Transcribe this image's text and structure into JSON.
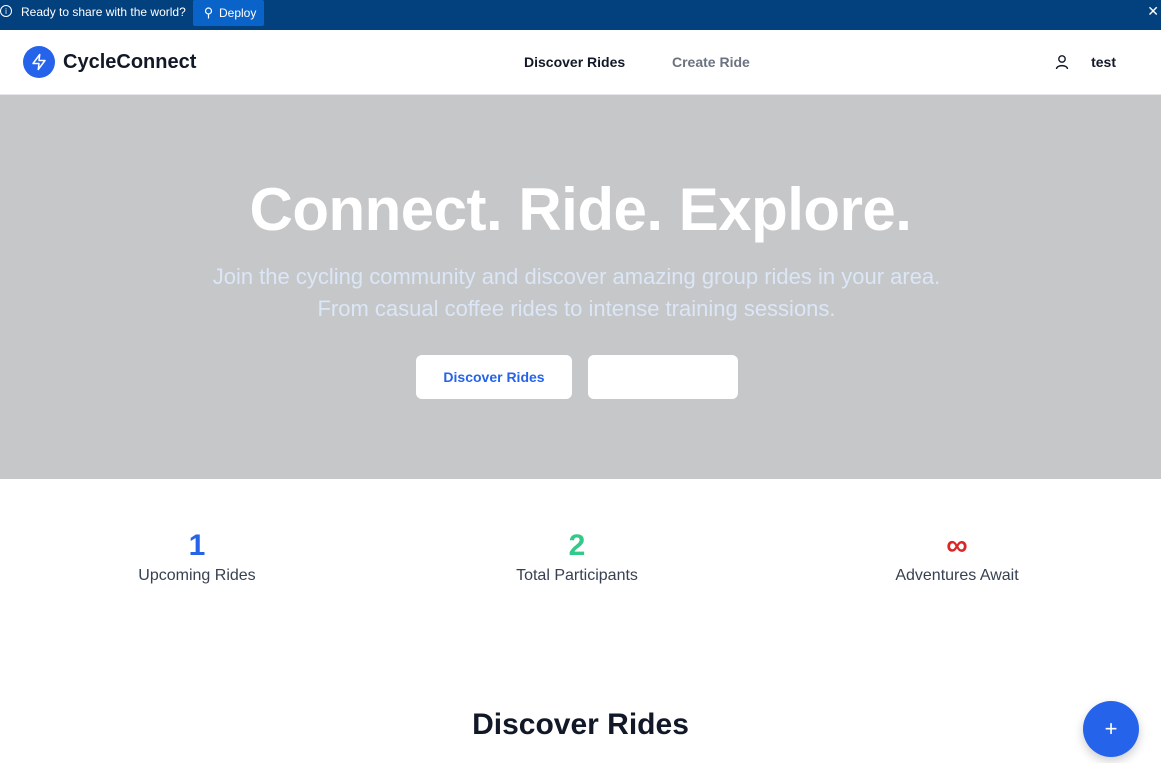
{
  "banner": {
    "text": "Ready to share with the world?",
    "deploy_label": "Deploy",
    "close_glyph": "✕"
  },
  "navbar": {
    "brand": "CycleConnect",
    "links": [
      {
        "label": "Discover Rides",
        "active": true
      },
      {
        "label": "Create Ride",
        "active": false
      }
    ],
    "user_name": "test"
  },
  "hero": {
    "title": "Connect. Ride. Explore.",
    "subtitle": "Join the cycling community and discover amazing group rides in your area. From casual coffee rides to intense training sessions.",
    "primary_button": "Discover Rides",
    "secondary_button": ""
  },
  "stats": [
    {
      "value": "1",
      "label": "Upcoming Rides",
      "color": "#2563eb"
    },
    {
      "value": "2",
      "label": "Total Participants",
      "color": "#34c98b"
    },
    {
      "value": "∞",
      "label": "Adventures Await",
      "color": "#dc2626"
    }
  ],
  "section": {
    "title": "Discover Rides"
  },
  "fab": {
    "glyph": "+"
  },
  "colors": {
    "banner_bg": "#03417e",
    "accent": "#2563eb",
    "hero_bg": "#c6c7c9"
  }
}
